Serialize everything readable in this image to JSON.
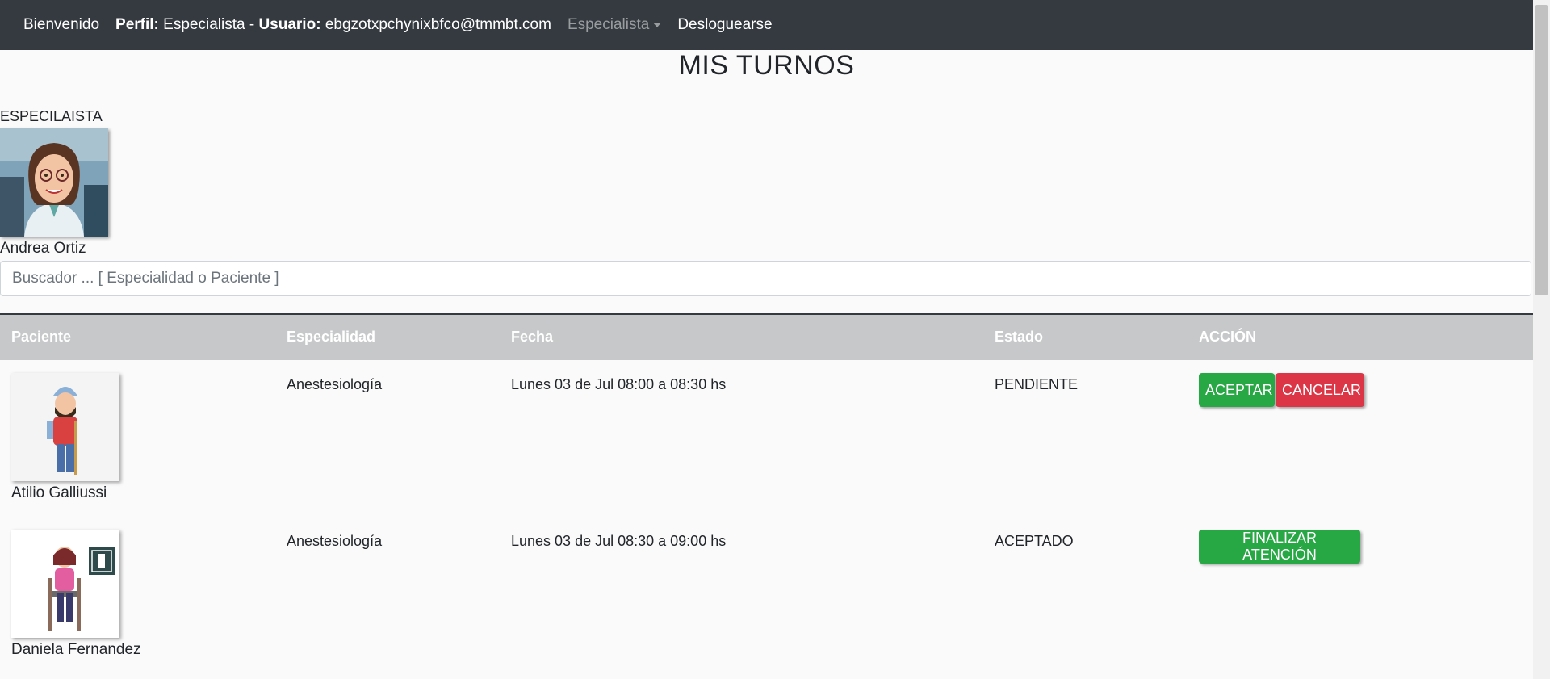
{
  "navbar": {
    "welcome": "Bienvenido",
    "profile_label": "Perfil:",
    "profile_value": "Especialista -",
    "user_label": "Usuario:",
    "user_value": "ebgzotxpchynixbfco@tmmbt.com",
    "dropdown": "Especialista",
    "logout": "Desloguearse"
  },
  "page": {
    "title": "MIS TURNOS",
    "role_label": "ESPECILAISTA",
    "specialist_name": "Andrea Ortiz"
  },
  "search": {
    "placeholder": "Buscador ... [ Especialidad o Paciente ]"
  },
  "table": {
    "headers": [
      "Paciente",
      "Especialidad",
      "Fecha",
      "Estado",
      "ACCIÓN"
    ],
    "rows": [
      {
        "patient": "Atilio Galliussi",
        "specialty": "Anestesiología",
        "date": "Lunes 03 de Jul 08:00 a 08:30 hs",
        "status": "PENDIENTE",
        "actions": [
          "ACEPTAR",
          "CANCELAR"
        ]
      },
      {
        "patient": "Daniela Fernandez",
        "specialty": "Anestesiología",
        "date": "Lunes 03 de Jul 08:30 a 09:00 hs",
        "status": "ACEPTADO",
        "actions": [
          "FINALIZAR ATENCIÓN"
        ]
      }
    ]
  },
  "colors": {
    "navbar": "#343a40",
    "header": "#c6c8ca",
    "accept": "#28a745",
    "cancel": "#dc3545"
  }
}
